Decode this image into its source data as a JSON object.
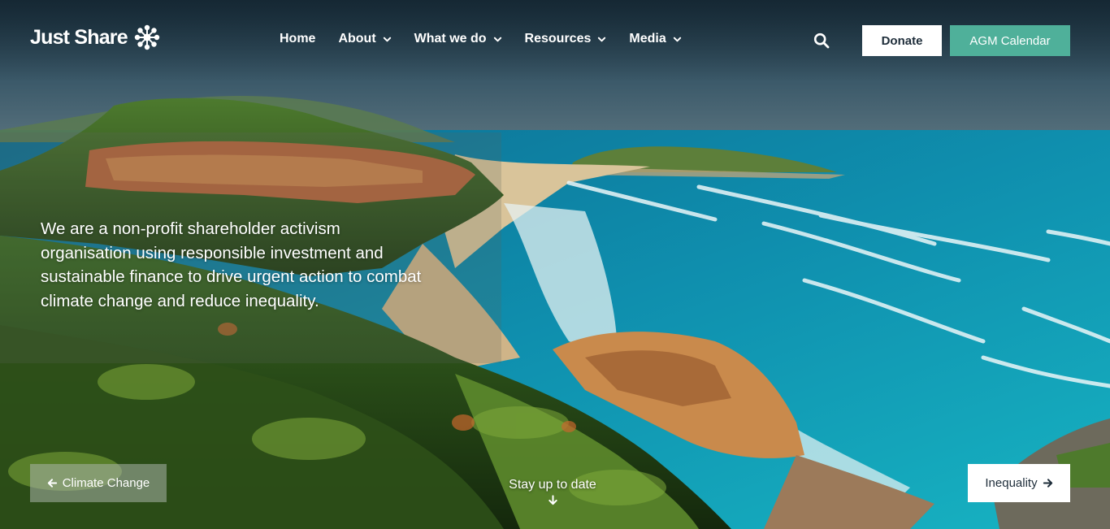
{
  "brand": {
    "name": "Just Share",
    "logo_icon": "starburst-logo-icon"
  },
  "nav": {
    "items": [
      {
        "label": "Home",
        "has_dropdown": false
      },
      {
        "label": "About",
        "has_dropdown": true
      },
      {
        "label": "What we do",
        "has_dropdown": true
      },
      {
        "label": "Resources",
        "has_dropdown": true
      },
      {
        "label": "Media",
        "has_dropdown": true
      }
    ],
    "search_icon": "search-icon"
  },
  "actions": {
    "donate_label": "Donate",
    "agm_label": "AGM Calendar"
  },
  "hero": {
    "mission": "We are a non-profit shareholder activism organisation using responsible investment and sustainable finance to drive urgent action to combat climate change and reduce inequality.",
    "prev_label": "Climate Change",
    "next_label": "Inequality",
    "stay_label": "Stay up to date"
  },
  "colors": {
    "accent": "#4fb09a",
    "donate_bg": "#ffffff",
    "dark_text": "#1e2d3a"
  }
}
